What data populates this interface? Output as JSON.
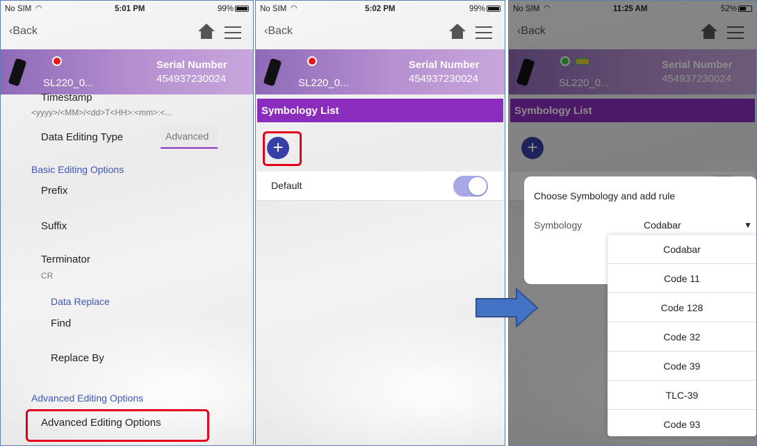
{
  "panels": [
    {
      "status": {
        "carrier": "No SIM",
        "time": "5:01 PM",
        "battery": "99%"
      },
      "nav": {
        "back": "Back"
      },
      "device": {
        "model": "SL220_0...",
        "serial_label": "Serial Number",
        "serial_value": "454937230024"
      },
      "content": {
        "timestamp_label": "Timestamp",
        "timestamp_value": "<yyyy>/<MM>/<dd>T<HH>:<mm>:<...",
        "data_editing_type_label": "Data Editing Type",
        "data_editing_type_value": "Advanced",
        "basic_header": "Basic Editing Options",
        "prefix": "Prefix",
        "suffix": "Suffix",
        "terminator": "Terminator",
        "terminator_value": "CR",
        "data_replace_header": "Data Replace",
        "find": "Find",
        "replace_by": "Replace By",
        "advanced_header": "Advanced Editing Options",
        "advanced_item": "Advanced Editing Options"
      }
    },
    {
      "status": {
        "carrier": "No SIM",
        "time": "5:02 PM",
        "battery": "99%"
      },
      "nav": {
        "back": "Back"
      },
      "device": {
        "model": "SL220_0...",
        "serial_label": "Serial Number",
        "serial_value": "454937230024"
      },
      "content": {
        "list_header": "Symbology List",
        "default_label": "Default",
        "add": "+"
      }
    },
    {
      "status": {
        "carrier": "No SIM",
        "time": "11:25 AM",
        "battery": "52%"
      },
      "nav": {
        "back": "Back"
      },
      "device": {
        "model": "SL220_0...",
        "serial_label": "Serial Number",
        "serial_value": "454937230024"
      },
      "content": {
        "list_header": "Symbology List",
        "add": "+",
        "dialog_title": "Choose Symbology and add rule",
        "symbology_label": "Symbology",
        "symbology_value": "Codabar",
        "options": [
          "Codabar",
          "Code 11",
          "Code 128",
          "Code 32",
          "Code 39",
          "TLC-39",
          "Code 93"
        ]
      }
    }
  ],
  "colors": {
    "header_purple": "#8a2dbd",
    "accent_blue": "#3f56b4",
    "highlight_red": "#e3001b",
    "arrow_blue": "#4472c4"
  }
}
